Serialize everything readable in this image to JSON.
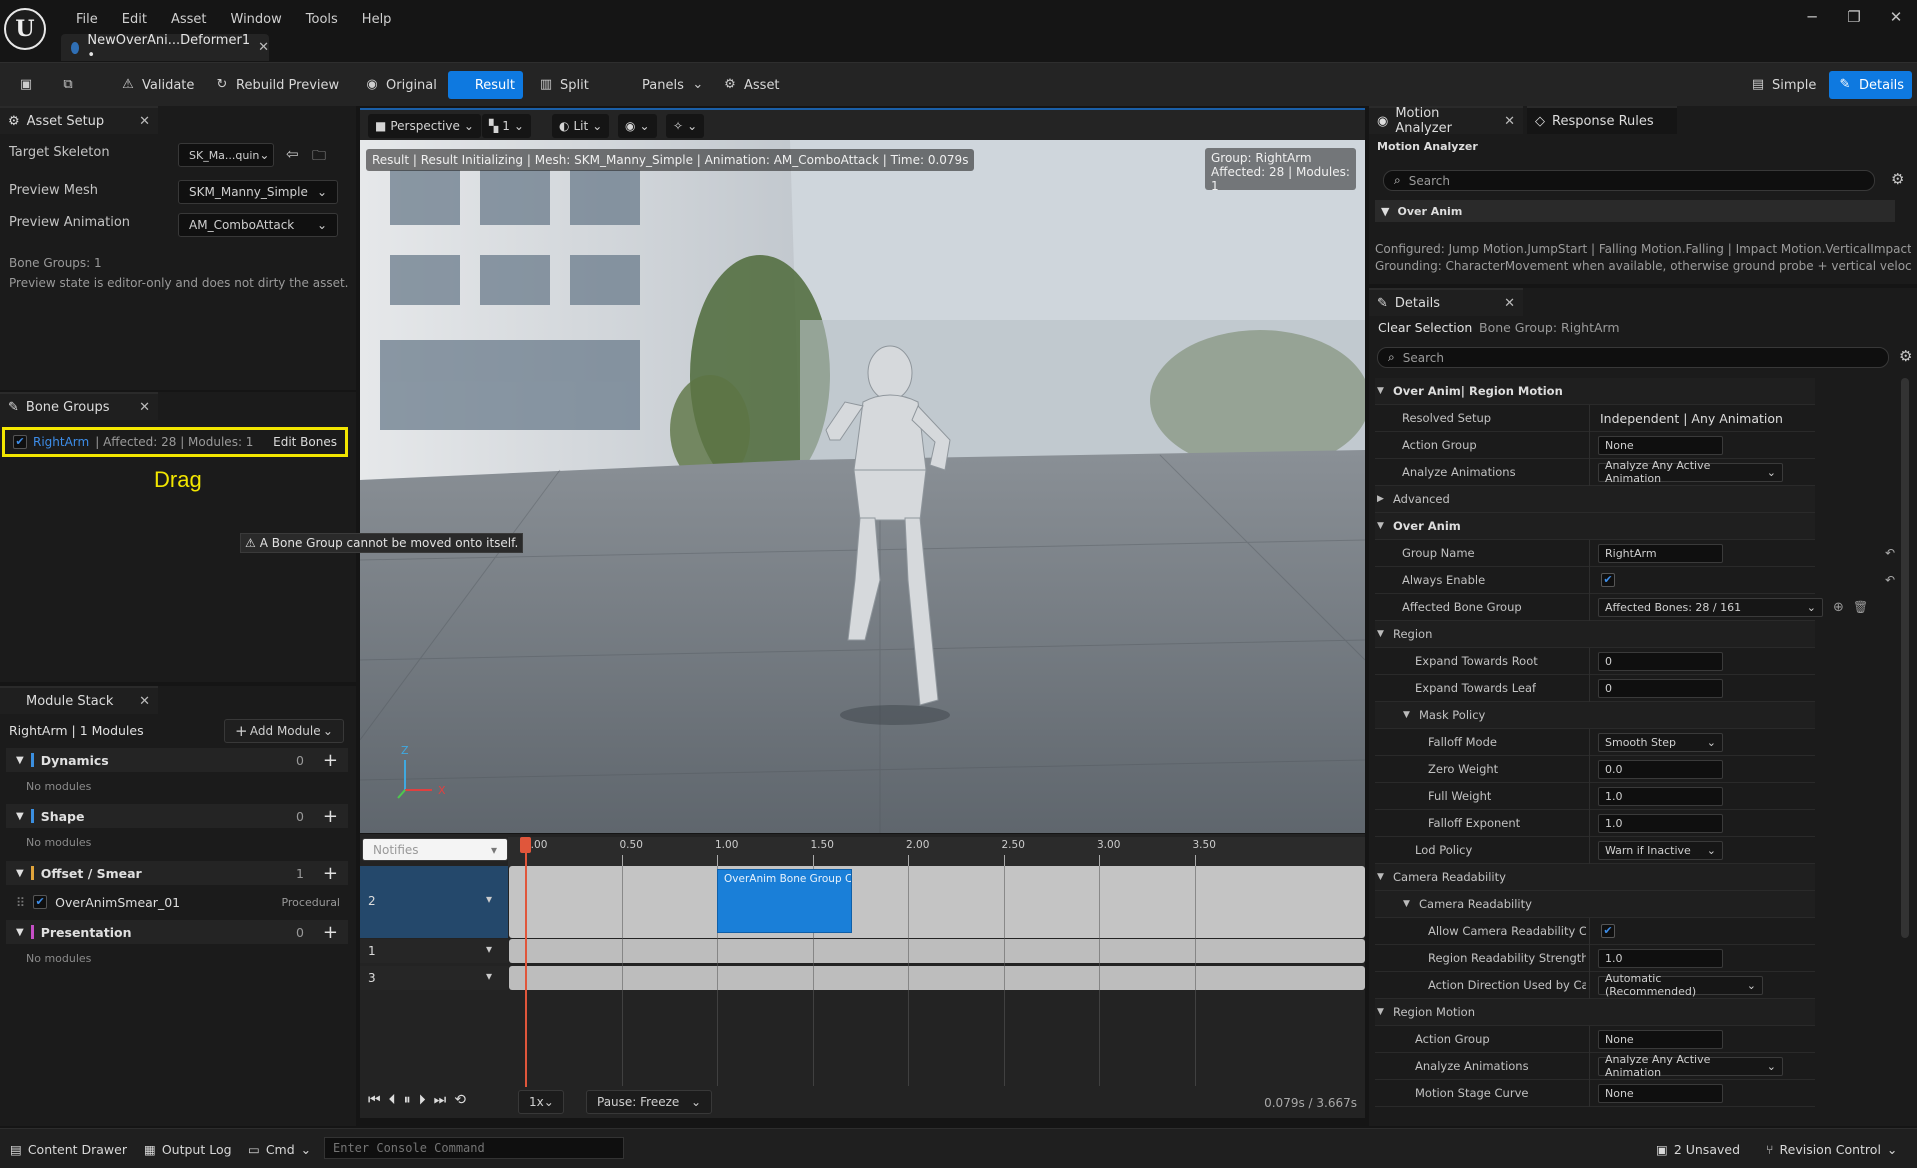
{
  "app": {
    "menu": [
      "File",
      "Edit",
      "Asset",
      "Window",
      "Tools",
      "Help"
    ],
    "doc_tab": "NewOverAni...Deformer1 •"
  },
  "toolbar": {
    "validate": "Validate",
    "rebuild": "Rebuild Preview",
    "original": "Original",
    "result": "Result",
    "split": "Split",
    "panels": "Panels",
    "asset": "Asset",
    "simple": "Simple",
    "details": "Details"
  },
  "asset_setup": {
    "tab": "Asset Setup",
    "target_skeleton_label": "Target Skeleton",
    "target_skeleton_value": "SK_Ma...quin",
    "preview_mesh_label": "Preview Mesh",
    "preview_mesh_value": "SKM_Manny_Simple",
    "preview_anim_label": "Preview Animation",
    "preview_anim_value": "AM_ComboAttack",
    "bone_groups_count": "Bone Groups: 1",
    "note": "Preview state is editor-only and does not dirty the asset."
  },
  "bone_groups": {
    "tab": "Bone Groups",
    "item_name": "RightArm",
    "item_affected": "|  Affected: 28  |  Modules: 1",
    "edit_bones": "Edit Bones",
    "drag_label": "Drag",
    "tooltip": "A Bone Group cannot be moved onto itself."
  },
  "module_stack": {
    "tab": "Module Stack",
    "header": "RightArm  |  1 Modules",
    "add_module": "Add Module",
    "sections": [
      {
        "name": "Dynamics",
        "count": "0",
        "empty": "No modules",
        "color": "#3b8fe0"
      },
      {
        "name": "Shape",
        "count": "0",
        "empty": "No modules",
        "color": "#3b8fe0"
      },
      {
        "name": "Offset / Smear",
        "count": "1",
        "empty": "",
        "color": "#e0a43b"
      },
      {
        "name": "Presentation",
        "count": "0",
        "empty": "No modules",
        "color": "#c64fc6"
      }
    ],
    "module_item": "OverAnimSmear_01",
    "module_type": "Procedural"
  },
  "viewport": {
    "perspective": "Perspective",
    "cam_num": "1",
    "lit": "Lit",
    "info": "Result | Result Initializing | Mesh: SKM_Manny_Simple | Animation: AM_ComboAttack | Time: 0.079s",
    "group_line1": "Group: RightArm",
    "group_line2": "Affected: 28 | Modules: 1",
    "axis_z": "Z",
    "axis_x": "X"
  },
  "timeline": {
    "notifies": "Notifies",
    "ticks": [
      "0.00",
      "0.50",
      "1.00",
      "1.50",
      "2.00",
      "2.50",
      "3.00",
      "3.50"
    ],
    "tracks": [
      "2",
      "1",
      "3"
    ],
    "clip": "OverAnim Bone Group C",
    "speed": "1x",
    "pause": "Pause: Freeze",
    "time": "0.079s / 3.667s"
  },
  "motion_analyzer": {
    "tab": "Motion Analyzer",
    "tab2": "Response Rules",
    "title": "Motion Analyzer",
    "search": "Search",
    "section": "Over Anim",
    "line1": "Configured: Jump Motion.JumpStart | Falling Motion.Falling | Impact Motion.VerticalImpact | S",
    "line2": "Grounding: CharacterMovement when available, otherwise ground probe + vertical velocity th"
  },
  "details": {
    "tab": "Details",
    "clear": "Clear Selection",
    "bone_group": "Bone Group: RightArm",
    "search": "Search",
    "rows": [
      {
        "type": "cat",
        "indent": 0,
        "label": "Over Anim| Region Motion",
        "arrow": "▼"
      },
      {
        "type": "text",
        "indent": 1,
        "label": "Resolved Setup",
        "value": "Independent | Any Animation"
      },
      {
        "type": "field",
        "indent": 1,
        "label": "Action Group",
        "value": "None",
        "w": 125
      },
      {
        "type": "combo",
        "indent": 1,
        "label": "Analyze Animations",
        "value": "Analyze Any Active Animation",
        "w": 185
      },
      {
        "type": "cat2",
        "indent": 0,
        "label": "Advanced",
        "arrow": "▶"
      },
      {
        "type": "cat",
        "indent": 0,
        "label": "Over Anim",
        "arrow": "▼"
      },
      {
        "type": "field",
        "indent": 1,
        "label": "Group Name",
        "value": "RightArm",
        "w": 125,
        "reset": true
      },
      {
        "type": "check",
        "indent": 1,
        "label": "Always Enable",
        "reset": true
      },
      {
        "type": "combo",
        "indent": 1,
        "label": "Affected Bone Group",
        "value": "Affected Bones: 28 / 161",
        "w": 225,
        "extra": true
      },
      {
        "type": "cat2",
        "indent": 0,
        "label": "Region",
        "arrow": "▼"
      },
      {
        "type": "field",
        "indent": 2,
        "label": "Expand Towards Root",
        "value": "0",
        "w": 125
      },
      {
        "type": "field",
        "indent": 2,
        "label": "Expand Towards Leaf",
        "value": "0",
        "w": 125
      },
      {
        "type": "cat2",
        "indent": 2,
        "label": "Mask Policy",
        "arrow": "▼"
      },
      {
        "type": "combo",
        "indent": 3,
        "label": "Falloff Mode",
        "value": "Smooth Step",
        "w": 125
      },
      {
        "type": "field",
        "indent": 3,
        "label": "Zero Weight",
        "value": "0.0",
        "w": 125
      },
      {
        "type": "field",
        "indent": 3,
        "label": "Full Weight",
        "value": "1.0",
        "w": 125
      },
      {
        "type": "field",
        "indent": 3,
        "label": "Falloff Exponent",
        "value": "1.0",
        "w": 125
      },
      {
        "type": "combo",
        "indent": 2,
        "label": "Lod Policy",
        "value": "Warn if Inactive",
        "w": 125
      },
      {
        "type": "cat2",
        "indent": 0,
        "label": "Camera Readability",
        "arrow": "▼"
      },
      {
        "type": "cat2",
        "indent": 2,
        "label": "Camera Readability",
        "arrow": "▼"
      },
      {
        "type": "check",
        "indent": 3,
        "label": "Allow Camera Readability Co..."
      },
      {
        "type": "field",
        "indent": 3,
        "label": "Region Readability Strength",
        "value": "1.0",
        "w": 125
      },
      {
        "type": "combo",
        "indent": 3,
        "label": "Action Direction Used by Ca...",
        "value": "Automatic (Recommended)",
        "w": 165
      },
      {
        "type": "cat2",
        "indent": 0,
        "label": "Region Motion",
        "arrow": "▼"
      },
      {
        "type": "field",
        "indent": 2,
        "label": "Action Group",
        "value": "None",
        "w": 125
      },
      {
        "type": "combo",
        "indent": 2,
        "label": "Analyze Animations",
        "value": "Analyze Any Active Animation",
        "w": 185
      },
      {
        "type": "field",
        "indent": 2,
        "label": "Motion Stage Curve",
        "value": "None",
        "w": 125
      }
    ]
  },
  "statusbar": {
    "content_drawer": "Content Drawer",
    "output_log": "Output Log",
    "cmd": "Cmd",
    "console_placeholder": "Enter Console Command",
    "unsaved": "2 Unsaved",
    "revision": "Revision Control"
  },
  "colors": {
    "accent": "#0e79e0",
    "highlight": "#f2e600",
    "playhead": "#e0563b",
    "clip": "#1a7fd8"
  }
}
